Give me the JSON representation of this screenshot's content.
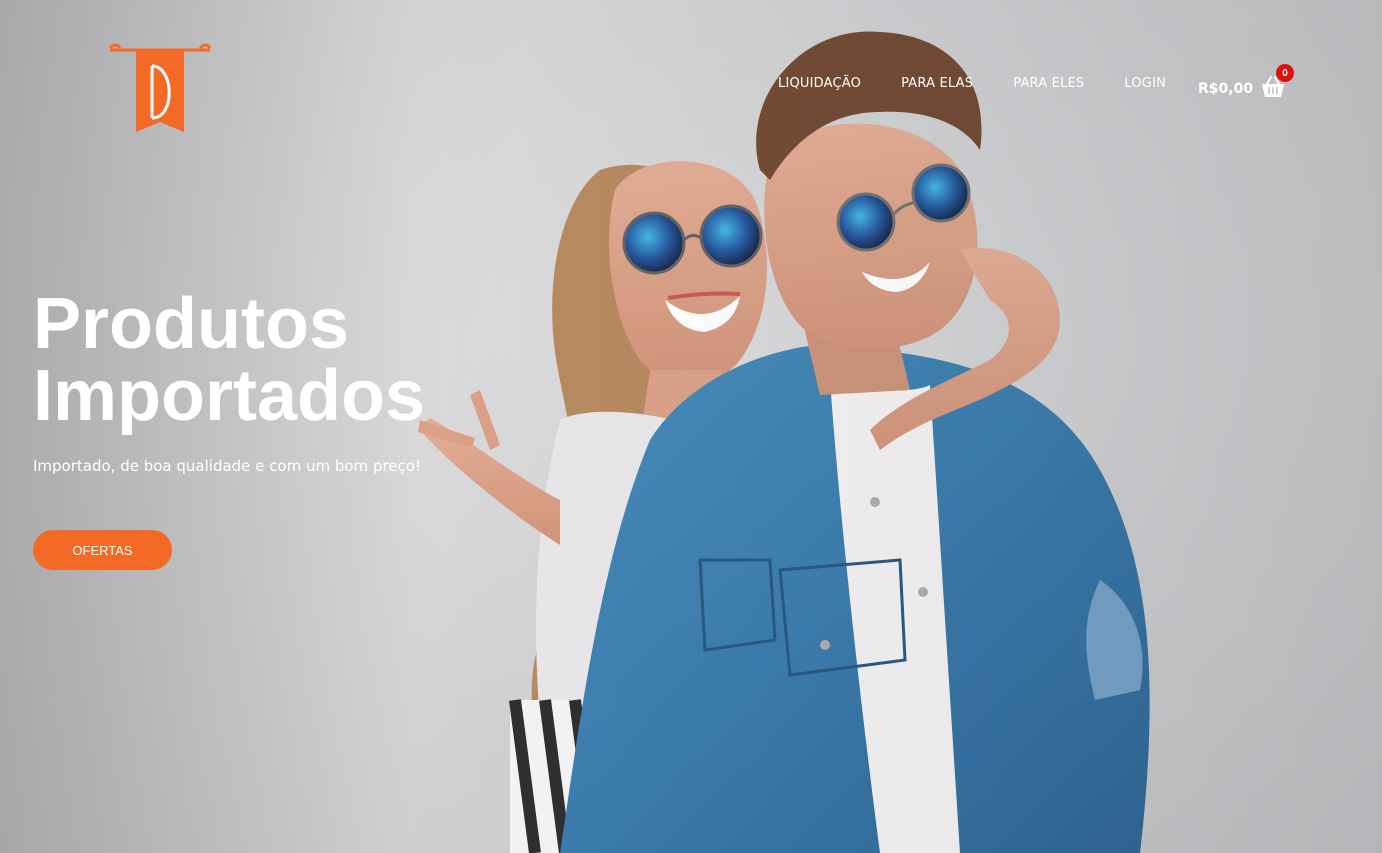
{
  "header": {
    "logo_icon": "pennant-d-logo",
    "nav": [
      {
        "label": "LIQUIDAÇÃO"
      },
      {
        "label": "PARA ELAS"
      },
      {
        "label": "PARA ELES"
      },
      {
        "label": "LOGIN"
      }
    ],
    "cart": {
      "total": "R$0,00",
      "count": "0",
      "icon": "basket-icon"
    }
  },
  "hero": {
    "title_line1": "Produtos",
    "title_line2": "Importados",
    "subtitle": "Importado, de boa qualidade e com um bom preço!",
    "button_label": "OFERTAS"
  },
  "colors": {
    "accent": "#f26a25",
    "badge": "#e01010",
    "text": "#ffffff"
  }
}
